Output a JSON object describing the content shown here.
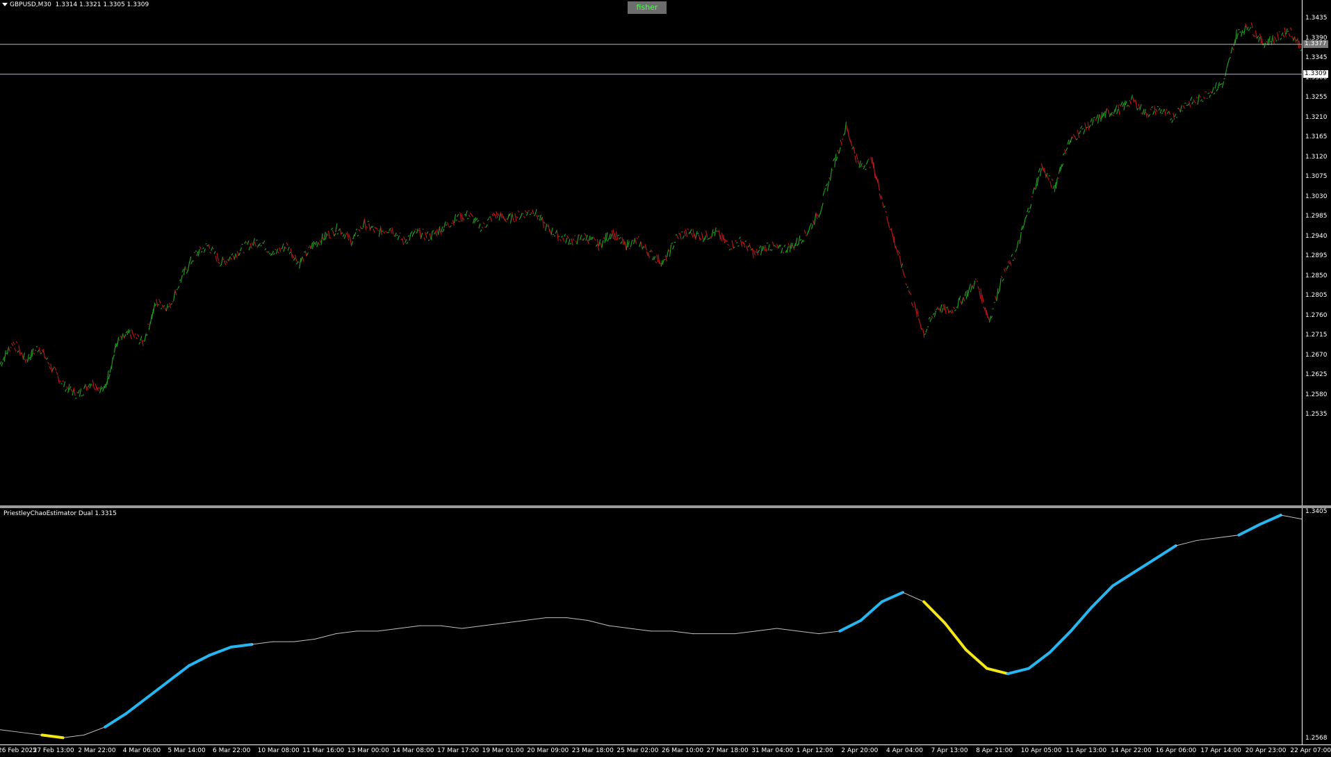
{
  "symbol_header": {
    "symbol": "GBPUSD,M30",
    "ohlc": "1.3314 1.3321 1.3305 1.3309"
  },
  "fisher_button": "fisher",
  "main_price_labels": [
    "1.3435",
    "1.3390",
    "1.3345",
    "1.3300",
    "1.3255",
    "1.3210",
    "1.3165",
    "1.3120",
    "1.3075",
    "1.3030",
    "1.2985",
    "1.2940",
    "1.2895",
    "1.2850",
    "1.2805",
    "1.2760",
    "1.2715",
    "1.2670",
    "1.2625",
    "1.2580",
    "1.2535"
  ],
  "hline_tags": {
    "upper": "1.3377",
    "lower": "1.3309"
  },
  "indicator": {
    "title": "PriestleyChaoEstimator Dual 1.3315",
    "top_label": "1.3405",
    "bottom_label": "1.2568"
  },
  "time_labels": [
    "26 Feb 2025",
    "27 Feb 13:00",
    "2 Mar 22:00",
    "4 Mar 06:00",
    "5 Mar 14:00",
    "6 Mar 22:00",
    "10 Mar 08:00",
    "11 Mar 16:00",
    "13 Mar 00:00",
    "14 Mar 08:00",
    "17 Mar 17:00",
    "19 Mar 01:00",
    "20 Mar 09:00",
    "23 Mar 18:00",
    "25 Mar 02:00",
    "26 Mar 10:00",
    "27 Mar 18:00",
    "31 Mar 04:00",
    "1 Apr 12:00",
    "2 Apr 20:00",
    "4 Apr 04:00",
    "7 Apr 13:00",
    "8 Apr 21:00",
    "10 Apr 05:00",
    "11 Apr 13:00",
    "14 Apr 22:00",
    "16 Apr 06:00",
    "17 Apr 14:00",
    "20 Apr 23:00",
    "22 Apr 07:00"
  ],
  "colors": {
    "bull": "#1f9a1f",
    "bear": "#b01818",
    "up_trend": "#27b6ef",
    "down_trend": "#f3e619",
    "neutral": "#bfbfbf",
    "hline": "#b8b8cc"
  },
  "chart_data": [
    {
      "type": "line",
      "title": "",
      "series": [
        {
          "values": [
            1.265,
            1.27,
            1.266,
            1.269,
            1.264,
            1.26,
            1.258,
            1.261,
            1.259,
            1.27,
            1.272,
            1.27,
            1.279,
            1.278,
            1.285,
            1.29,
            1.292,
            1.288,
            1.29,
            1.292,
            1.293,
            1.29,
            1.292,
            1.288,
            1.292,
            1.294,
            1.296,
            1.293,
            1.297,
            1.295,
            1.296,
            1.293,
            1.295,
            1.294,
            1.296,
            1.298,
            1.299,
            1.296,
            1.299,
            1.298,
            1.299,
            1.3,
            1.296,
            1.294,
            1.293,
            1.294,
            1.292,
            1.295,
            1.292,
            1.293,
            1.29,
            1.288,
            1.294,
            1.295,
            1.294,
            1.295,
            1.292,
            1.293,
            1.29,
            1.292,
            1.291,
            1.292,
            1.295,
            1.3,
            1.31,
            1.319,
            1.31,
            1.311,
            1.3,
            1.29,
            1.28,
            1.272,
            1.278,
            1.277,
            1.28,
            1.284,
            1.275,
            1.285,
            1.29,
            1.3,
            1.31,
            1.305,
            1.315,
            1.318,
            1.32,
            1.322,
            1.323,
            1.325,
            1.322,
            1.323,
            1.321,
            1.324,
            1.325,
            1.327,
            1.329,
            1.34,
            1.342,
            1.338,
            1.339,
            1.341,
            1.337
          ]
        }
      ],
      "xlabel": "",
      "ylabel": "",
      "ylim": [
        1.2535,
        1.346
      ]
    },
    {
      "type": "line",
      "title": "",
      "series": [
        {
          "values": [
            1.26,
            1.259,
            1.258,
            1.257,
            1.258,
            1.261,
            1.266,
            1.272,
            1.278,
            1.284,
            1.288,
            1.291,
            1.292,
            1.293,
            1.293,
            1.294,
            1.296,
            1.297,
            1.297,
            1.298,
            1.299,
            1.299,
            1.298,
            1.299,
            1.3,
            1.301,
            1.302,
            1.302,
            1.301,
            1.299,
            1.298,
            1.297,
            1.297,
            1.296,
            1.296,
            1.296,
            1.297,
            1.298,
            1.297,
            1.296,
            1.297,
            1.301,
            1.308,
            1.3115,
            1.308,
            1.3,
            1.29,
            1.283,
            1.281,
            1.283,
            1.289,
            1.297,
            1.306,
            1.314,
            1.319,
            1.324,
            1.329,
            1.331,
            1.332,
            1.333,
            1.337,
            1.3405,
            1.339
          ],
          "segments": [
            "neutral",
            "neutral",
            "down",
            "neutral",
            "neutral",
            "up",
            "up",
            "up",
            "up",
            "up",
            "up",
            "up",
            "neutral",
            "neutral",
            "neutral",
            "neutral",
            "neutral",
            "neutral",
            "neutral",
            "neutral",
            "neutral",
            "neutral",
            "neutral",
            "neutral",
            "neutral",
            "neutral",
            "neutral",
            "neutral",
            "neutral",
            "neutral",
            "neutral",
            "neutral",
            "neutral",
            "neutral",
            "neutral",
            "neutral",
            "neutral",
            "neutral",
            "neutral",
            "neutral",
            "up",
            "up",
            "up",
            "neutral",
            "down",
            "down",
            "down",
            "down",
            "up",
            "up",
            "up",
            "up",
            "up",
            "up",
            "up",
            "up",
            "neutral",
            "neutral",
            "neutral",
            "up",
            "up",
            "neutral",
            "down"
          ]
        }
      ],
      "xlabel": "",
      "ylabel": "",
      "ylim": [
        1.2568,
        1.3405
      ]
    }
  ]
}
